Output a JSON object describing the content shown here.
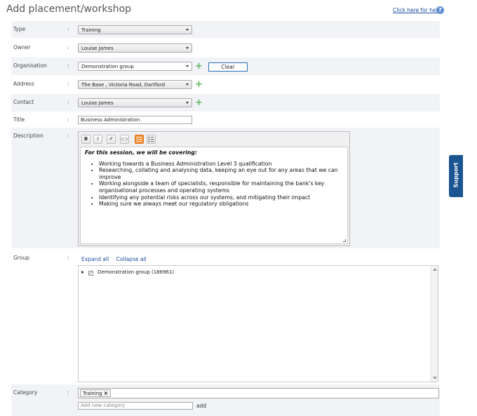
{
  "page": {
    "title": "Add placement/workshop",
    "help_link": "Click here for help",
    "help_icon": "?"
  },
  "form": {
    "colon": ":",
    "type": {
      "label": "Type",
      "value": "Training"
    },
    "owner": {
      "label": "Owner",
      "value": "Louise James"
    },
    "organisation": {
      "label": "Organisation",
      "value": "Demonstration group",
      "clear_label": "Clear"
    },
    "address": {
      "label": "Address",
      "value": "The Base , Victoria Road, Dartford"
    },
    "contact": {
      "label": "Contact",
      "value": "Louise James"
    },
    "title": {
      "label": "Title",
      "value": "Business Administration"
    },
    "description": {
      "label": "Description",
      "toolbar": {
        "bold": "B",
        "italic": "I",
        "clear": "✐",
        "link": "⊂⊃"
      },
      "heading": "For this session, we will be covering:",
      "items": [
        "Working towards a Business Administration Level 3 qualification",
        "Researching, collating and analysing data, keeping an eye out for any areas that we can improve",
        "Working alongside a team of specialists, responsible for maintaining the bank's key organisational processes and operating systems",
        "Identifying any potential risks across our systems, and mitigating their impact",
        "Making sure we always meet our regulatory obligations"
      ]
    },
    "group": {
      "label": "Group",
      "expand_all": "Expand all",
      "collapse_all": "Collapse all",
      "tree_item": "Demonstration group (186961)"
    },
    "category": {
      "label": "Category",
      "tag": "Training",
      "tag_remove": "×",
      "add_placeholder": "Add new category",
      "add_label": "add"
    }
  },
  "support": {
    "label": "Support"
  },
  "colors": {
    "accent_orange": "#f08a2c",
    "link_blue": "#1a4ea0",
    "plus_green": "#5cb85c",
    "support_blue": "#1a5592"
  }
}
